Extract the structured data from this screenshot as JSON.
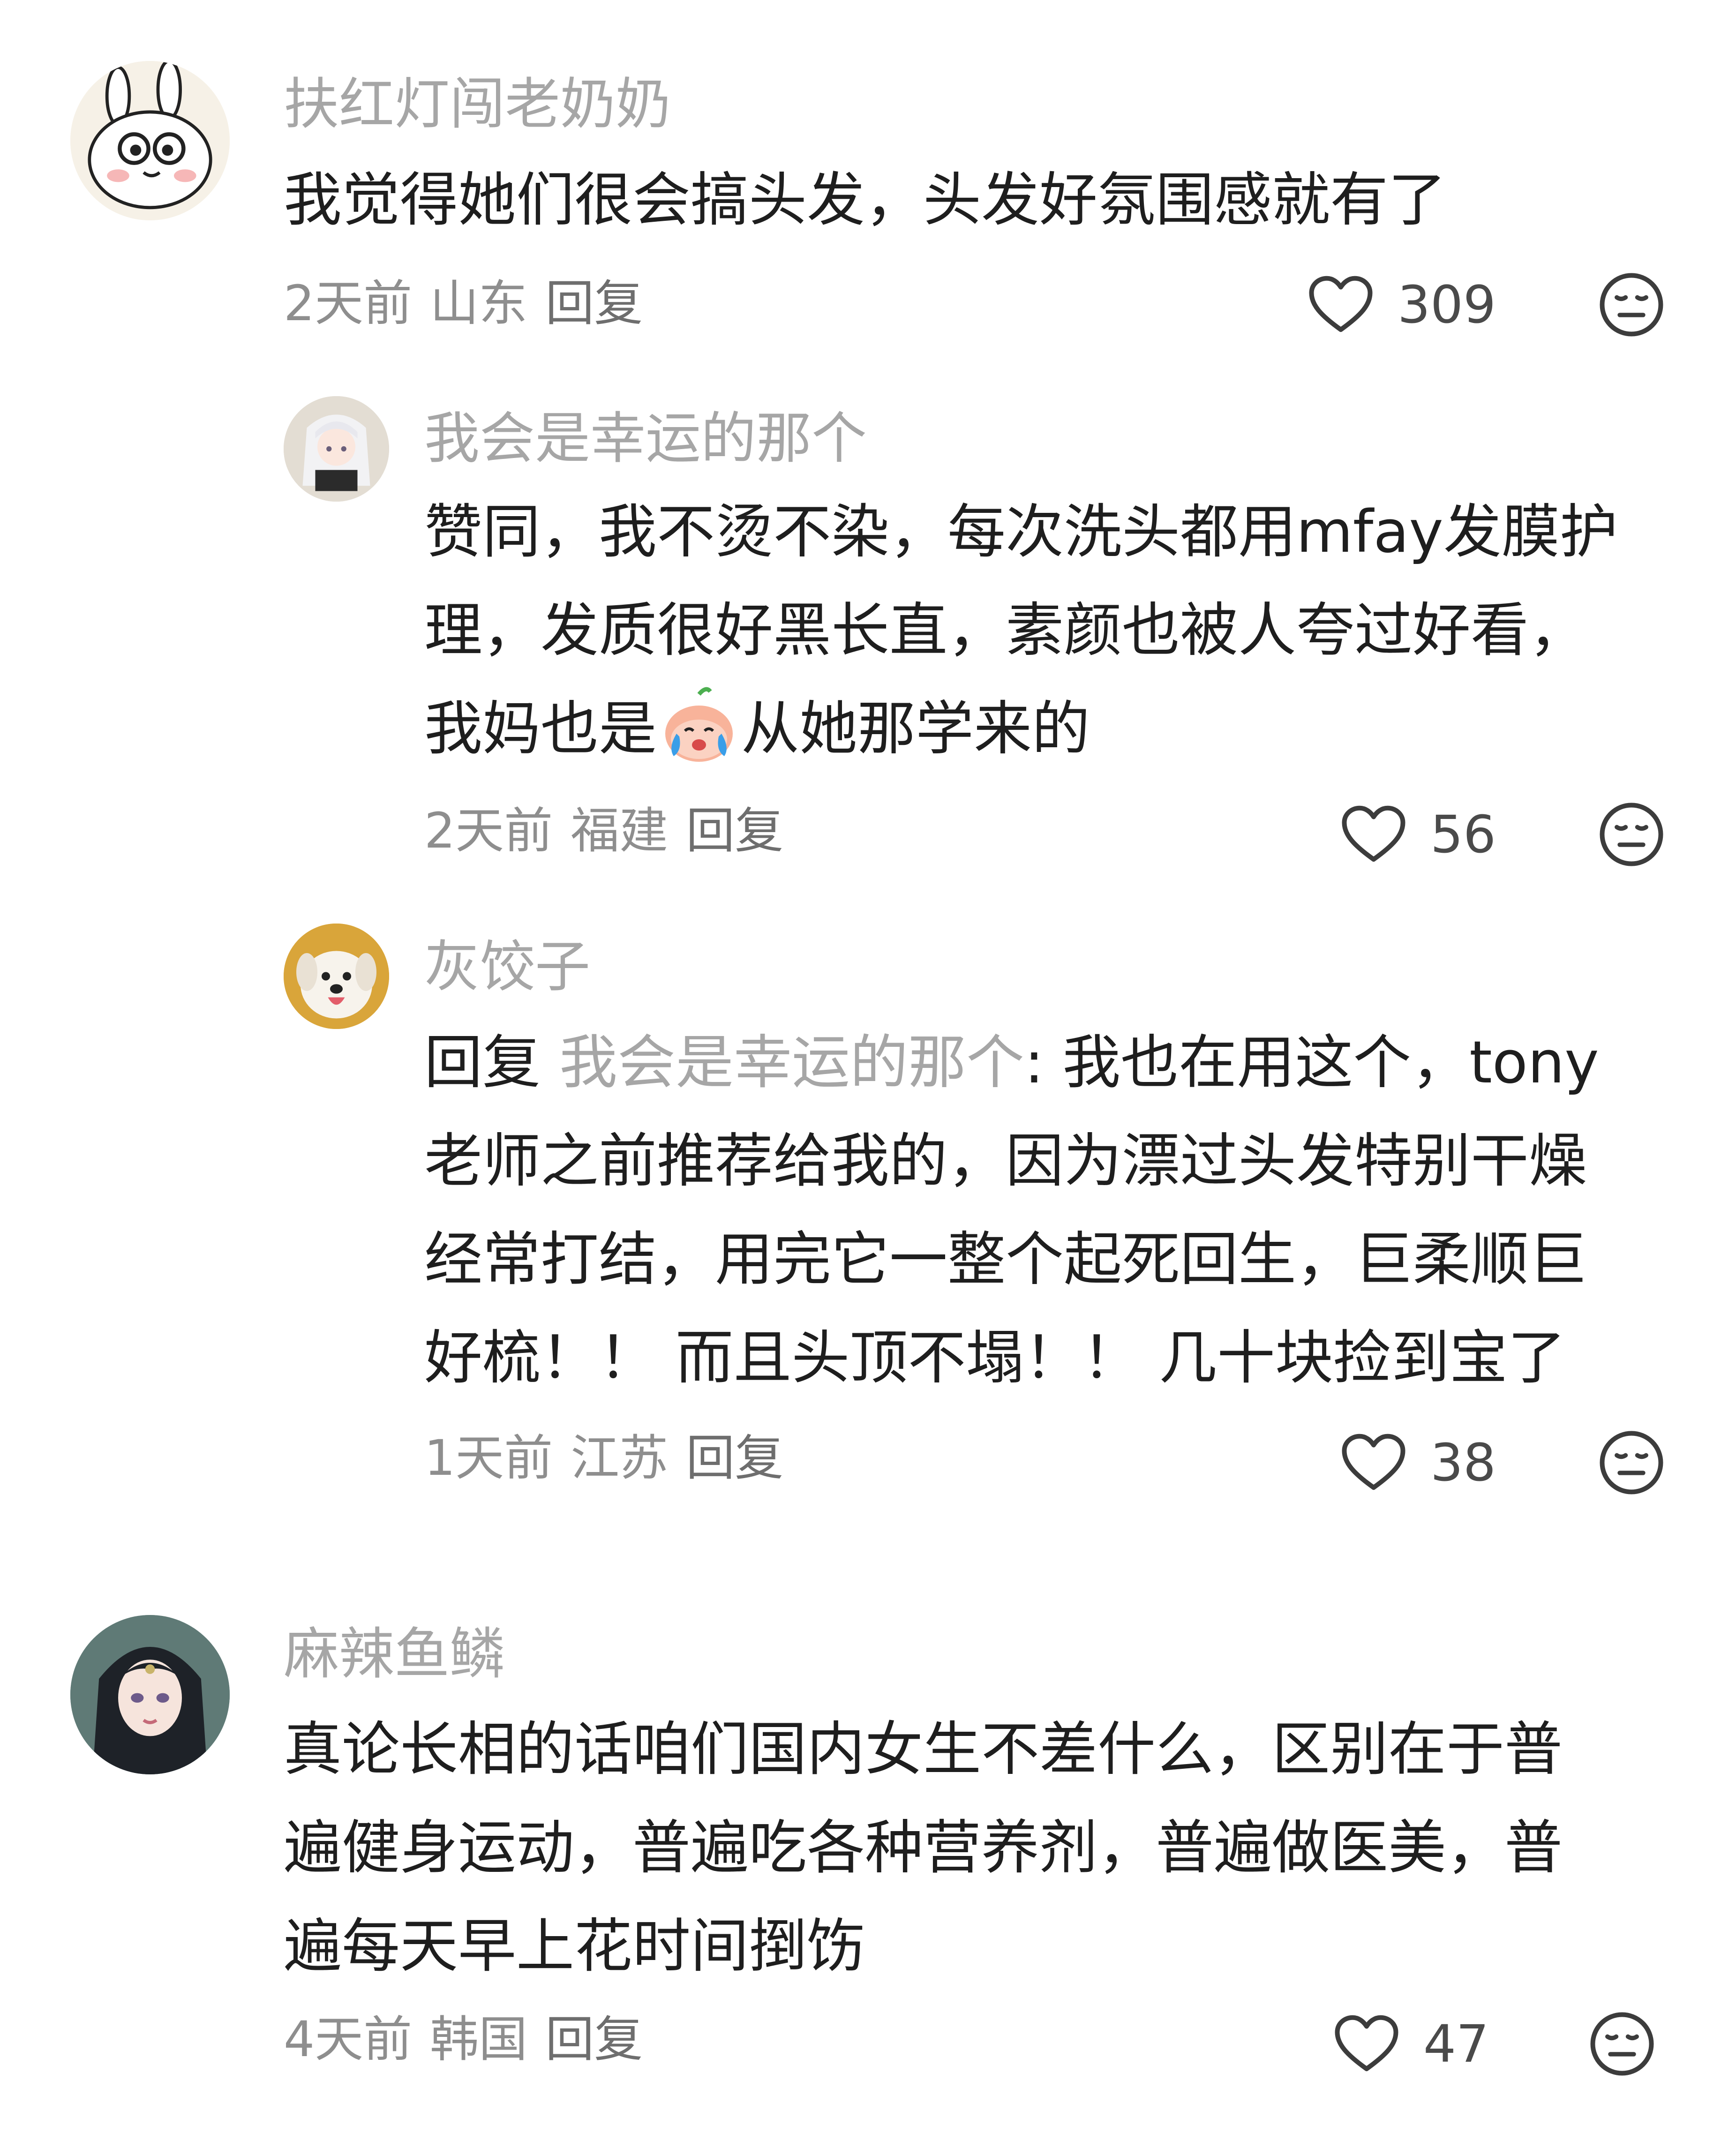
{
  "colors": {
    "username": "#a6a6a6",
    "text": "#1e1e1e",
    "meta": "#8e8e8e",
    "icon": "#3c3c3c"
  },
  "comments": [
    {
      "username": "扶红灯闯老奶奶",
      "avatar_icon": "bunny-avatar-icon",
      "lines": [
        "我觉得她们很会搞头发，头发好氛围感就有了"
      ],
      "time": "2天前",
      "location": "山东",
      "reply_label": "回复",
      "likes": "309"
    },
    {
      "username": "我会是幸运的那个",
      "avatar_icon": "anime-girl-avatar-icon",
      "lines": [
        "赞同，我不烫不染，每次洗头都用mfay发膜护",
        "理，发质很好黑长直，素颜也被人夸过好看，",
        "我妈也是",
        "从她那学来的"
      ],
      "inline_emoji": "crying-peach-emoji-icon",
      "time": "2天前",
      "location": "福建",
      "reply_label": "回复",
      "likes": "56"
    },
    {
      "username": "灰饺子",
      "avatar_icon": "dog-avatar-icon",
      "reply_prefix": "回复",
      "reply_target": "我会是幸运的那个",
      "lines": [
        ": 我也在用这个，tony",
        "老师之前推荐给我的，因为漂过头发特别干燥",
        "经常打结，用完它一整个起死回生，巨柔顺巨",
        "好梳！！ 而且头顶不塌！！ 几十块捡到宝了"
      ],
      "time": "1天前",
      "location": "江苏",
      "reply_label": "回复",
      "likes": "38"
    },
    {
      "username": "麻辣鱼鳞",
      "avatar_icon": "portrait-avatar-icon",
      "lines": [
        "真论长相的话咱们国内女生不差什么，区别在于普",
        "遍健身运动，普遍吃各种营养剂，普遍做医美，普",
        "遍每天早上花时间捯饬"
      ],
      "time": "4天前",
      "location": "韩国",
      "reply_label": "回复",
      "likes": "47"
    }
  ]
}
